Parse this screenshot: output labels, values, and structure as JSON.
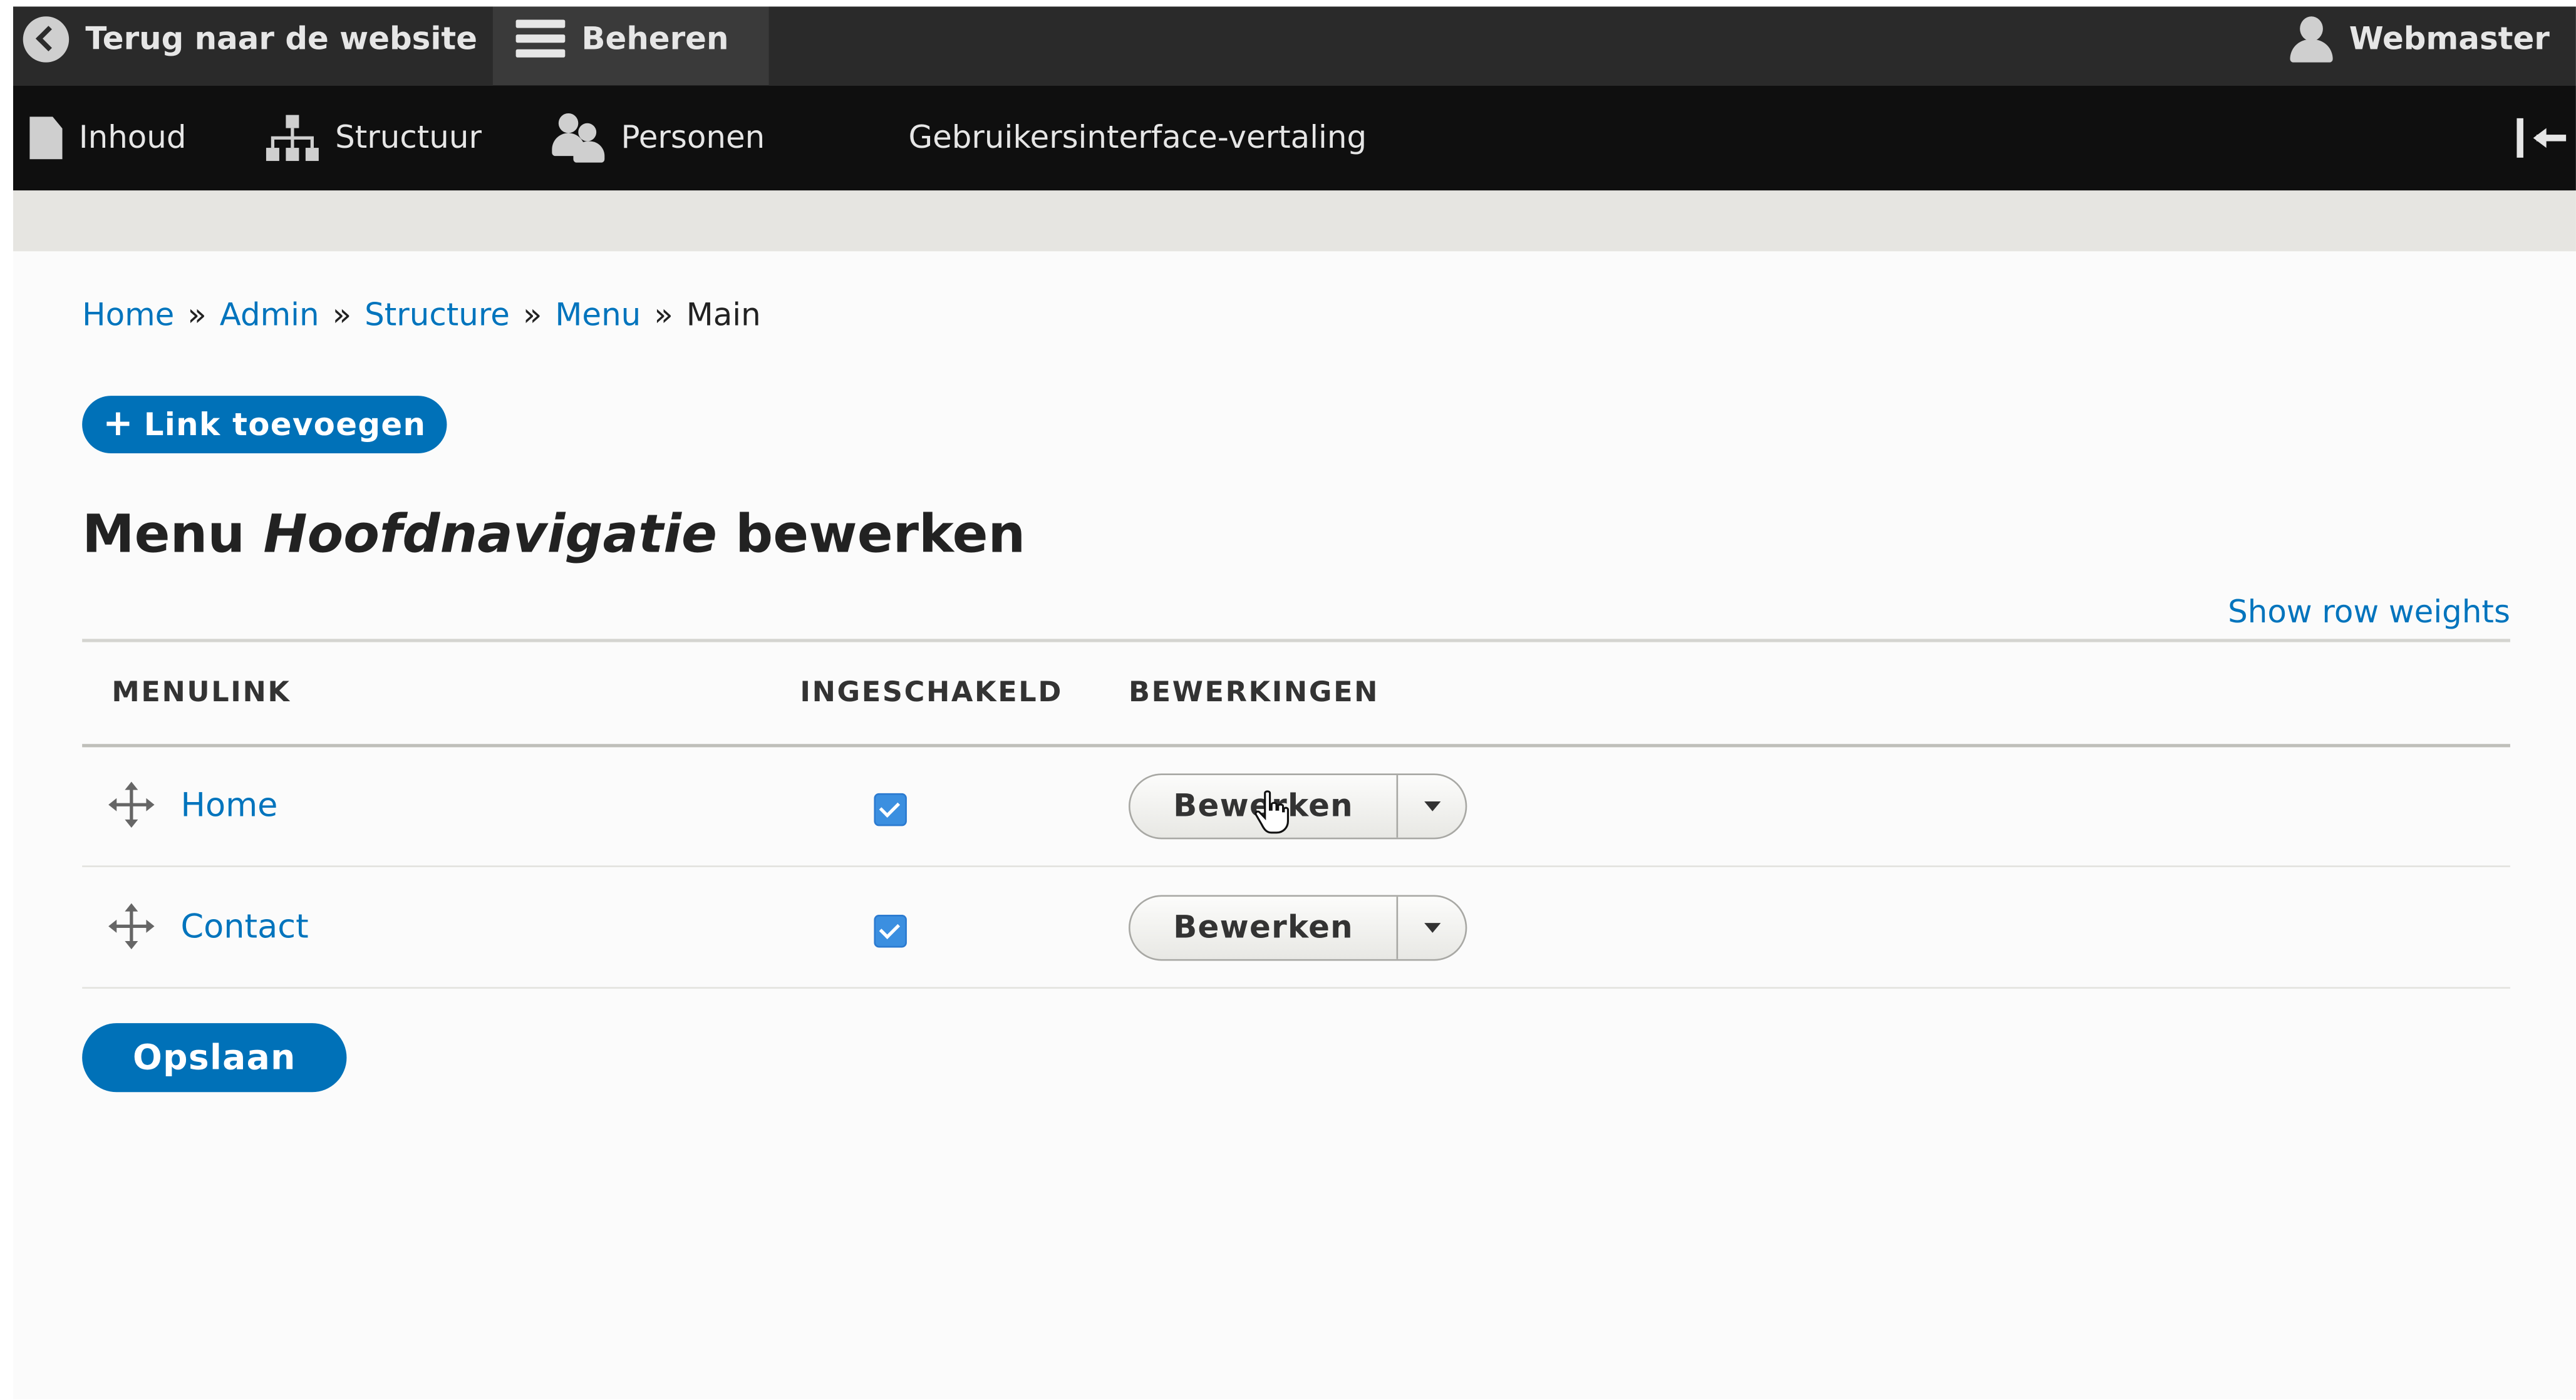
{
  "toolbar": {
    "back_label": "Terug naar de website",
    "manage_label": "Beheren",
    "user_label": "Webmaster",
    "tray": {
      "content": "Inhoud",
      "structure": "Structuur",
      "people": "Personen",
      "translation": "Gebruikersinterface-vertaling"
    }
  },
  "breadcrumb": {
    "items": [
      "Home",
      "Admin",
      "Structure",
      "Menu"
    ],
    "current": "Main",
    "separator": "»"
  },
  "actions": {
    "add_link_plus": "+",
    "add_link_label": "Link toevoegen"
  },
  "page": {
    "title_prefix": "Menu",
    "title_name": "Hoofdnavigatie",
    "title_suffix": "bewerken"
  },
  "table": {
    "show_row_weights": "Show row weights",
    "headers": {
      "menulink": "MENULINK",
      "enabled": "INGESCHAKELD",
      "operations": "BEWERKINGEN"
    },
    "rows": [
      {
        "label": "Home",
        "enabled": true,
        "operation": "Bewerken"
      },
      {
        "label": "Contact",
        "enabled": true,
        "operation": "Bewerken"
      }
    ]
  },
  "form": {
    "save_label": "Opslaan"
  },
  "colors": {
    "toolbar_top": "#2a2a2a",
    "toolbar_tray": "#0f0f0f",
    "link": "#0074bd",
    "primary_button": "#0071b8",
    "checkbox": "#3b8fe0"
  },
  "icons": {
    "back": "back-arrow-circle-icon",
    "manage": "hamburger-icon",
    "user": "user-icon",
    "content": "document-icon",
    "structure": "sitemap-icon",
    "people": "people-icon",
    "collapse": "collapse-arrow-icon",
    "drag": "drag-handle-icon",
    "dropdown": "caret-down-icon",
    "cursor": "hand-pointer-icon"
  }
}
